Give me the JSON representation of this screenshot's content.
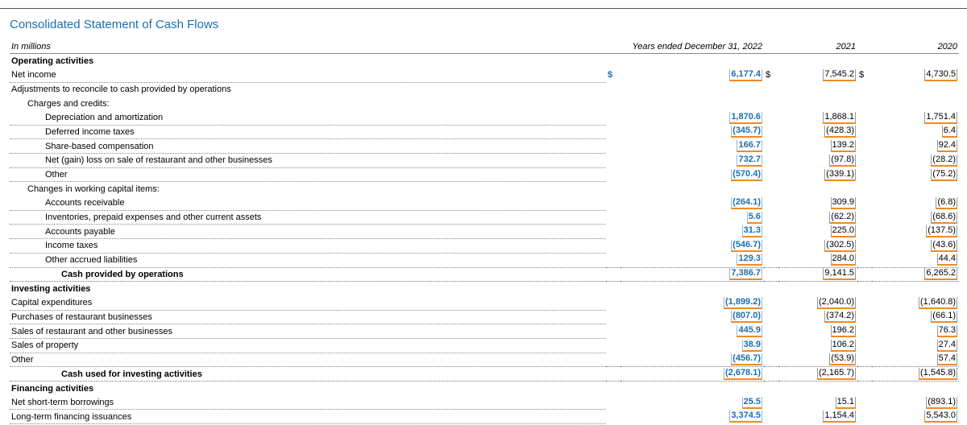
{
  "title": "Consolidated Statement of Cash Flows",
  "header": {
    "units": "In millions",
    "col1": "Years ended December 31, 2022",
    "col2": "2021",
    "col3": "2020"
  },
  "rows": [
    {
      "type": "section",
      "label": "Operating activities"
    },
    {
      "type": "line",
      "level": 0,
      "label": "Net income",
      "c1": "$",
      "v1": "6,177.4",
      "c2": "$",
      "v2": "7,545.2",
      "c3": "$",
      "v3": "4,730.5"
    },
    {
      "type": "plain",
      "level": 0,
      "label": "Adjustments to reconcile to cash provided by operations"
    },
    {
      "type": "plain",
      "level": 1,
      "label": "Charges and credits:"
    },
    {
      "type": "line",
      "level": 2,
      "label": "Depreciation and amortization",
      "v1": "1,870.6",
      "v2": "1,868.1",
      "v3": "1,751.4"
    },
    {
      "type": "line",
      "level": 2,
      "label": "Deferred income taxes",
      "v1": "(345.7)",
      "v2": "(428.3)",
      "v3": "6.4"
    },
    {
      "type": "line",
      "level": 2,
      "label": "Share-based compensation",
      "v1": "166.7",
      "v2": "139.2",
      "v3": "92.4"
    },
    {
      "type": "line",
      "level": 2,
      "label": "Net (gain) loss on sale of restaurant and other businesses",
      "v1": "732.7",
      "v2": "(97.8)",
      "v3": "(28.2)"
    },
    {
      "type": "line",
      "level": 2,
      "label": "Other",
      "v1": "(570.4)",
      "v2": "(339.1)",
      "v3": "(75.2)"
    },
    {
      "type": "plain",
      "level": 1,
      "label": "Changes in working capital items:"
    },
    {
      "type": "line",
      "level": 2,
      "label": "Accounts receivable",
      "v1": "(264.1)",
      "v2": "309.9",
      "v3": "(6.8)"
    },
    {
      "type": "line",
      "level": 2,
      "label": "Inventories, prepaid expenses and other current assets",
      "v1": "5.6",
      "v2": "(62.2)",
      "v3": "(68.6)"
    },
    {
      "type": "line",
      "level": 2,
      "label": "Accounts payable",
      "v1": "31.3",
      "v2": "225.0",
      "v3": "(137.5)"
    },
    {
      "type": "line",
      "level": 2,
      "label": "Income taxes",
      "v1": "(546.7)",
      "v2": "(302.5)",
      "v3": "(43.6)"
    },
    {
      "type": "line",
      "level": 2,
      "label": "Other accrued liabilities",
      "v1": "129.3",
      "v2": "284.0",
      "v3": "44.4"
    },
    {
      "type": "total",
      "label": "Cash provided by operations",
      "v1": "7,386.7",
      "v2": "9,141.5",
      "v3": "6,265.2"
    },
    {
      "type": "section",
      "label": "Investing activities"
    },
    {
      "type": "line",
      "level": 0,
      "label": "Capital expenditures",
      "v1": "(1,899.2)",
      "v2": "(2,040.0)",
      "v3": "(1,640.8)"
    },
    {
      "type": "line",
      "level": 0,
      "label": "Purchases of restaurant businesses",
      "v1": "(807.0)",
      "v2": "(374.2)",
      "v3": "(66.1)"
    },
    {
      "type": "line",
      "level": 0,
      "label": "Sales of restaurant and other businesses",
      "v1": "445.9",
      "v2": "196.2",
      "v3": "76.3"
    },
    {
      "type": "line",
      "level": 0,
      "label": "Sales of property",
      "v1": "38.9",
      "v2": "106.2",
      "v3": "27.4"
    },
    {
      "type": "line",
      "level": 0,
      "label": "Other",
      "v1": "(456.7)",
      "v2": "(53.9)",
      "v3": "57.4"
    },
    {
      "type": "total",
      "label": "Cash used for investing activities",
      "v1": "(2,678.1)",
      "v2": "(2,165.7)",
      "v3": "(1,545.8)"
    },
    {
      "type": "section",
      "label": "Financing activities"
    },
    {
      "type": "line",
      "level": 0,
      "label": "Net short-term borrowings",
      "v1": "25.5",
      "v2": "15.1",
      "v3": "(893.1)"
    },
    {
      "type": "line",
      "level": 0,
      "label": "Long-term financing issuances",
      "v1": "3,374.5",
      "v2": "1,154.4",
      "v3": "5,543.0"
    }
  ]
}
